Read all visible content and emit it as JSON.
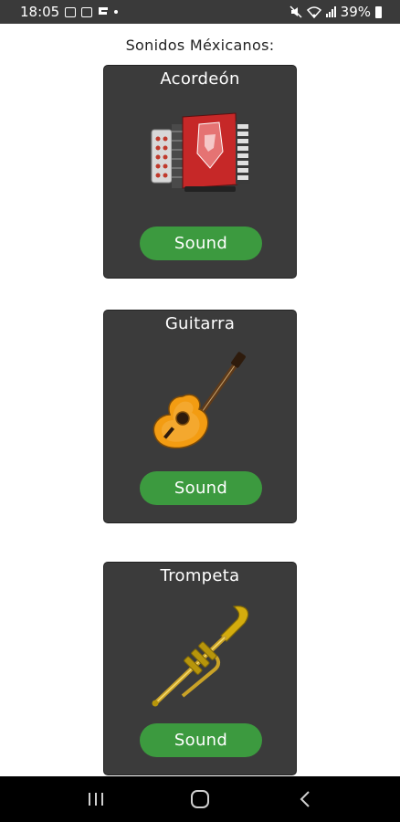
{
  "status_bar": {
    "time": "18:05",
    "notification_icons": [
      "image-icon",
      "mail-icon",
      "flag-icon"
    ],
    "battery_percent": "39%",
    "right_icons": [
      "mute-icon",
      "wifi-icon",
      "signal-icon",
      "battery-icon"
    ]
  },
  "heading": "Sonidos Méxicanos:",
  "cards": [
    {
      "title": "Acordeón",
      "button_label": "Sound",
      "icon": "accordion-icon"
    },
    {
      "title": "Guitarra",
      "button_label": "Sound",
      "icon": "guitar-icon"
    },
    {
      "title": "Trompeta",
      "button_label": "Sound",
      "icon": "trumpet-icon"
    }
  ],
  "nav_bar": {
    "buttons": [
      "recent-apps-icon",
      "home-icon",
      "back-icon"
    ]
  },
  "colors": {
    "card_bg": "#3b3b3b",
    "button_bg": "#3c9a3f",
    "status_bar_bg": "#3a3a3a",
    "nav_bar_bg": "#000000"
  }
}
